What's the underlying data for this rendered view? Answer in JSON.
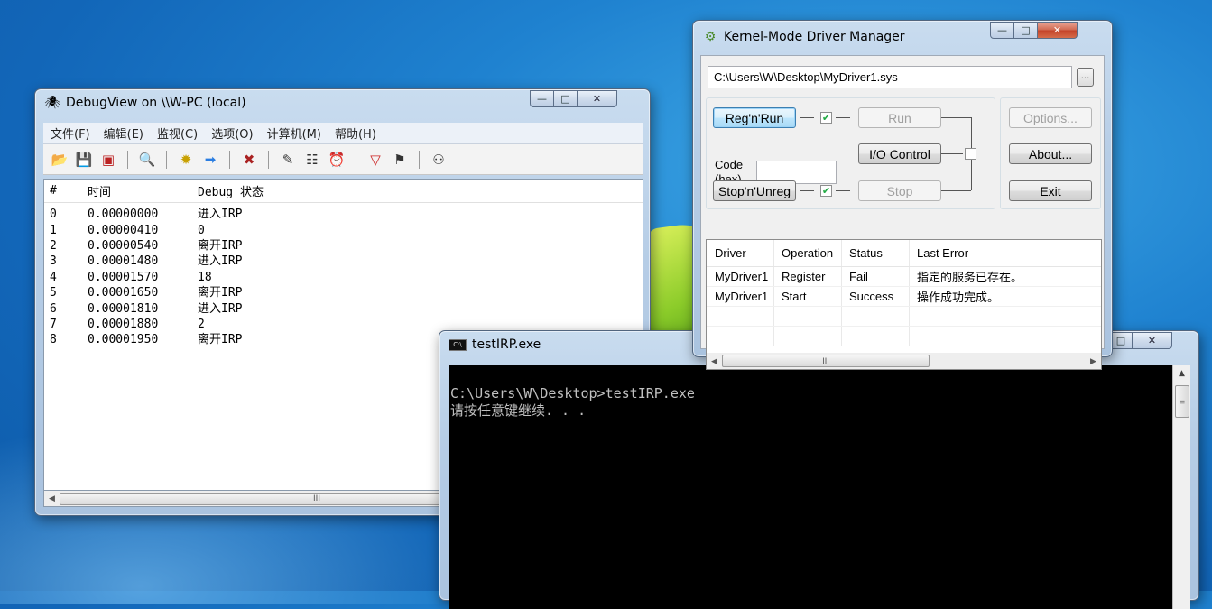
{
  "debugview": {
    "title": "DebugView on \\\\W-PC (local)",
    "menu": [
      "文件(F)",
      "编辑(E)",
      "监视(C)",
      "选项(O)",
      "计算机(M)",
      "帮助(H)"
    ],
    "columns": [
      "#",
      "时间",
      "Debug 状态"
    ],
    "rows": [
      {
        "n": "0",
        "time": "0.00000000",
        "msg": "进入IRP"
      },
      {
        "n": "1",
        "time": "0.00000410",
        "msg": "0"
      },
      {
        "n": "2",
        "time": "0.00000540",
        "msg": "离开IRP"
      },
      {
        "n": "3",
        "time": "0.00001480",
        "msg": "进入IRP"
      },
      {
        "n": "4",
        "time": "0.00001570",
        "msg": "18"
      },
      {
        "n": "5",
        "time": "0.00001650",
        "msg": "离开IRP"
      },
      {
        "n": "6",
        "time": "0.00001810",
        "msg": "进入IRP"
      },
      {
        "n": "7",
        "time": "0.00001880",
        "msg": "2"
      },
      {
        "n": "8",
        "time": "0.00001950",
        "msg": "离开IRP"
      }
    ],
    "scroll_grip": "III"
  },
  "console": {
    "title": "testIRP.exe",
    "icon_text": "C:\\",
    "lines": [
      "C:\\Users\\W\\Desktop>testIRP.exe",
      "请按任意键继续. . ."
    ]
  },
  "kdm": {
    "title": "Kernel-Mode Driver Manager",
    "path": "C:\\Users\\W\\Desktop\\MyDriver1.sys",
    "browse": "...",
    "buttons": {
      "regrun": "Reg'n'Run",
      "run": "Run",
      "io": "I/O Control",
      "stopunreg": "Stop'n'Unreg",
      "stop": "Stop",
      "options": "Options...",
      "about": "About...",
      "exit": "Exit"
    },
    "code_label_1": "Code",
    "code_label_2": "(hex)",
    "table_headers": [
      "Driver",
      "Operation",
      "Status",
      "Last Error"
    ],
    "table_rows": [
      {
        "driver": "MyDriver1",
        "op": "Register",
        "status": "Fail",
        "error": "指定的服务已存在。"
      },
      {
        "driver": "MyDriver1",
        "op": "Start",
        "status": "Success",
        "error": "操作成功完成。"
      }
    ],
    "scroll_grip": "III"
  }
}
